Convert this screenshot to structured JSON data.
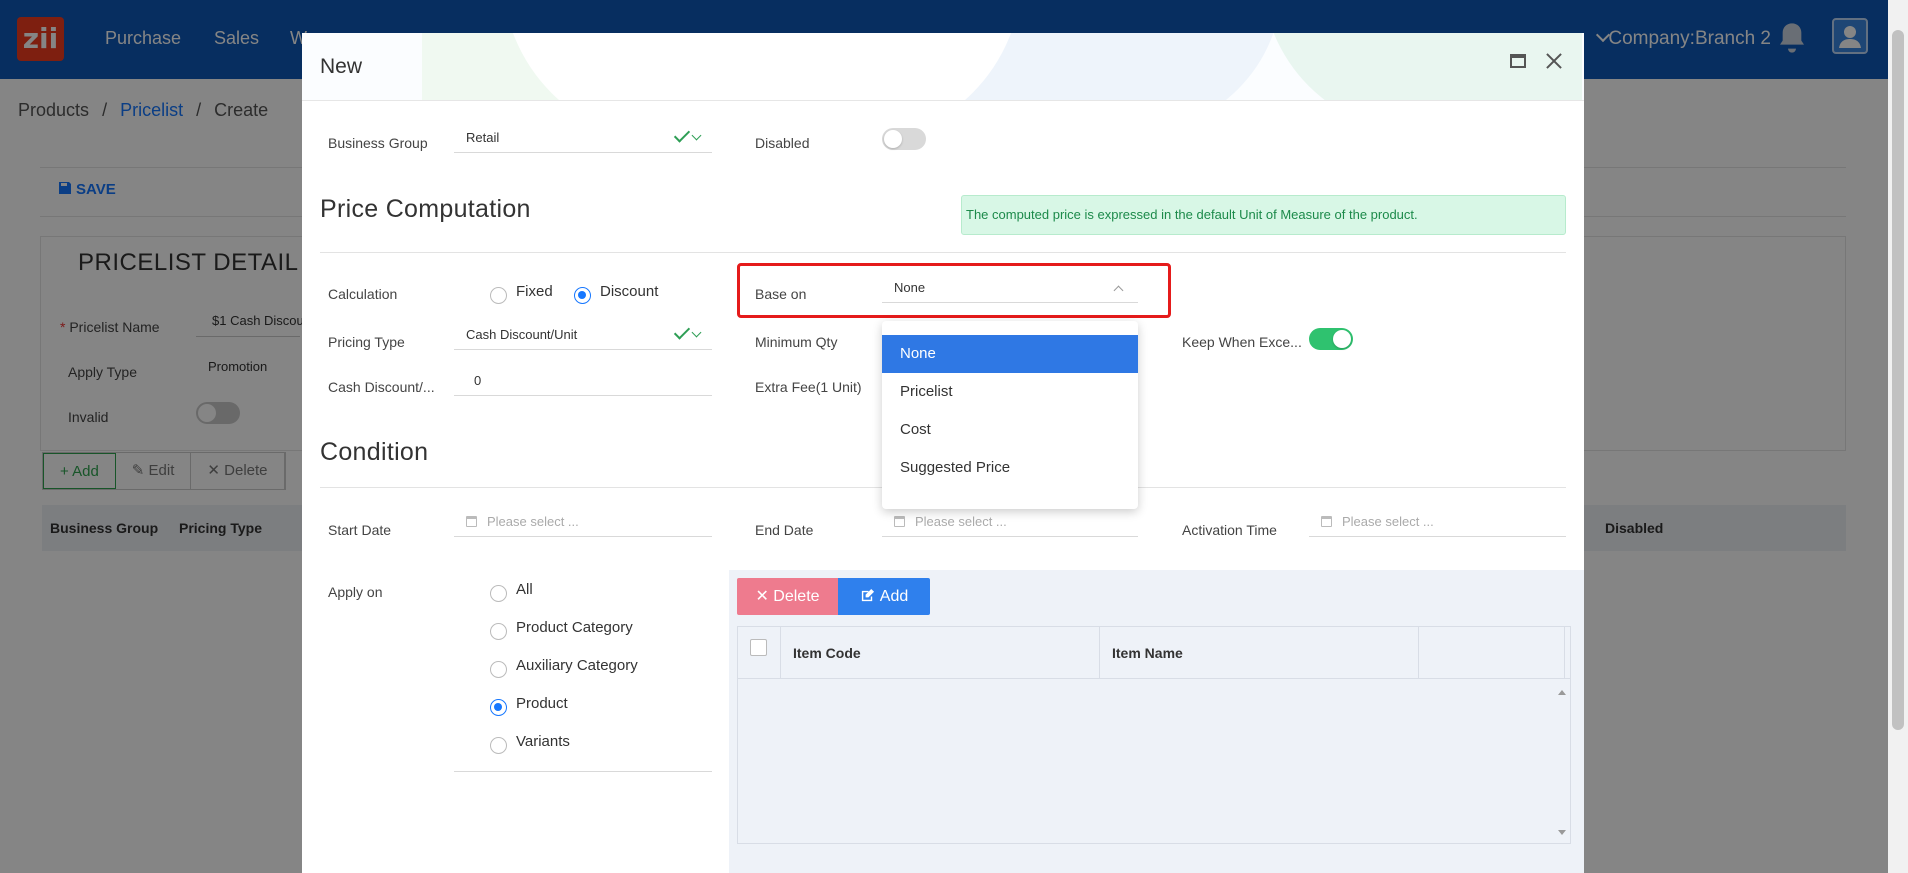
{
  "topbar": {
    "logo": "zii",
    "nav": [
      "Purchase",
      "Sales",
      "W"
    ],
    "company": "Company:Branch 2"
  },
  "breadcrumb": {
    "items": [
      "Products",
      "Pricelist",
      "Create"
    ],
    "sep": "/"
  },
  "background": {
    "save_label": "SAVE",
    "section_title": "PRICELIST DETAIL",
    "pricelist_name_label": "Pricelist Name",
    "pricelist_name_value": "$1 Cash Discou",
    "apply_type_label": "Apply Type",
    "apply_type_value": "Promotion",
    "invalid_label": "Invalid",
    "buttons": {
      "add": "+ Add",
      "edit": "Edit",
      "delete": "Delete"
    },
    "table_headers": [
      "Business Group",
      "Pricing Type",
      "Disabled"
    ]
  },
  "modal": {
    "title": "New",
    "business_group": {
      "label": "Business Group",
      "value": "Retail"
    },
    "disabled": {
      "label": "Disabled",
      "on": false
    },
    "price_computation": {
      "title": "Price Computation",
      "notice": "The computed price is expressed in the default Unit of Measure of the product.",
      "calculation": {
        "label": "Calculation",
        "options": [
          "Fixed",
          "Discount"
        ],
        "selected": "Discount"
      },
      "base_on": {
        "label": "Base on",
        "value": "None",
        "options": [
          "None",
          "Pricelist",
          "Cost",
          "Suggested Price"
        ]
      },
      "pricing_type": {
        "label": "Pricing Type",
        "value": "Cash Discount/Unit"
      },
      "minimum_qty": {
        "label": "Minimum Qty"
      },
      "keep_when_exceed": {
        "label": "Keep When Exce...",
        "on": true
      },
      "cash_discount": {
        "label": "Cash Discount/...",
        "value": "0"
      },
      "extra_fee": {
        "label": "Extra Fee(1 Unit)"
      }
    },
    "condition": {
      "title": "Condition",
      "start_date": {
        "label": "Start Date",
        "placeholder": "Please select ..."
      },
      "end_date": {
        "label": "End Date",
        "placeholder": "Please select ..."
      },
      "activation_time": {
        "label": "Activation Time",
        "placeholder": "Please select ..."
      },
      "apply_on": {
        "label": "Apply on",
        "options": [
          "All",
          "Product Category",
          "Auxiliary Category",
          "Product",
          "Variants"
        ],
        "selected": "Product"
      }
    },
    "items": {
      "delete_label": "✕ Delete",
      "add_label": "Add",
      "columns": [
        "Item Code",
        "Item Name"
      ]
    }
  },
  "colors": {
    "primary": "#1677ff",
    "success": "#2fc26f",
    "danger_highlight": "#e51b1b",
    "topbar": "#0f59b8"
  }
}
